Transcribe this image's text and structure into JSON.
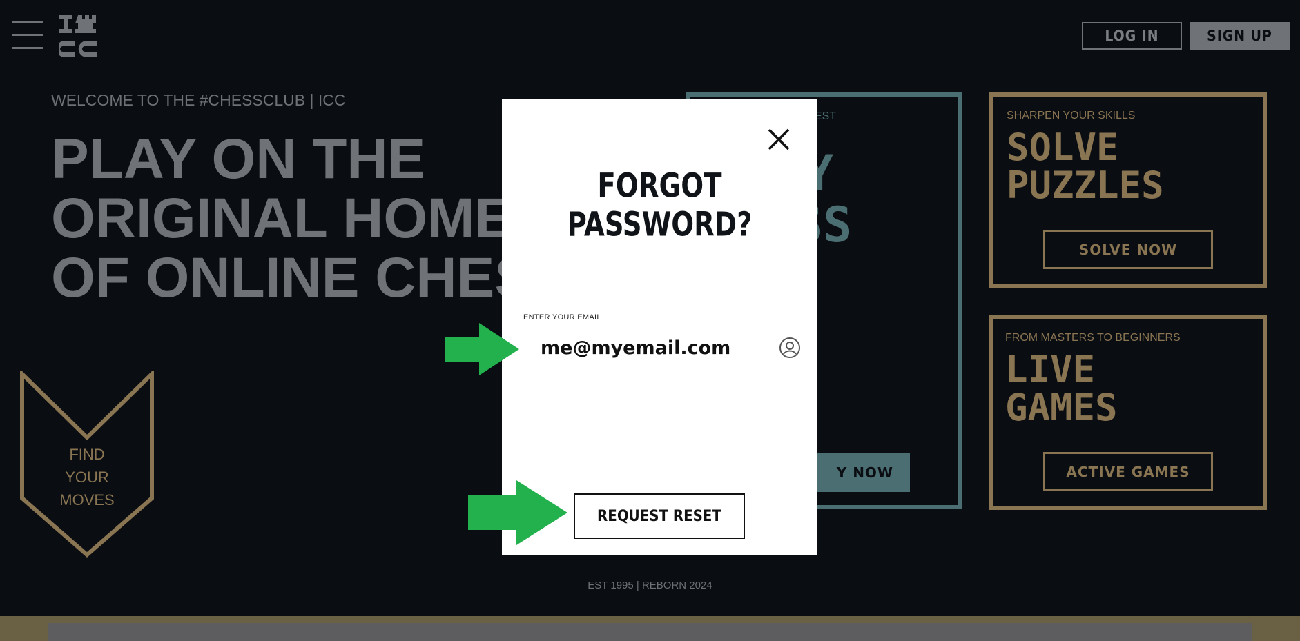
{
  "header": {
    "menu_icon": "hamburger-icon",
    "logo_icon": "icc-rook-logo",
    "login_label": "LOG IN",
    "signup_label": "SIGN UP"
  },
  "hero": {
    "welcome": "WELCOME TO THE #CHESSCLUB | ICC",
    "line1": "PLAY ON THE",
    "line2": "ORIGINAL HOME",
    "line3": "OF ONLINE CHESS"
  },
  "cards": {
    "teal": {
      "label_fragment": "EST",
      "big1_fragment": "Y",
      "big2_fragment": "SS",
      "button_fragment": "Y NOW"
    },
    "puzzles": {
      "label": "SHARPEN YOUR SKILLS",
      "title_line1": "SOLVE",
      "title_line2": "PUZZLES",
      "button": "SOLVE NOW"
    },
    "games": {
      "label": "FROM MASTERS TO BEGINNERS",
      "title_line1": "LIVE",
      "title_line2": "GAMES",
      "button": "ACTIVE GAMES"
    }
  },
  "chevron": {
    "line1": "FIND",
    "line2": "YOUR",
    "line3": "MOVES"
  },
  "footer": {
    "est": "EST 1995 | REBORN 2024"
  },
  "modal": {
    "title": "FORGOT PASSWORD?",
    "email_label": "ENTER YOUR EMAIL",
    "email_value": "me@myemail.com",
    "button": "REQUEST RESET",
    "close_icon": "close-icon",
    "user_icon": "user-circle-icon"
  },
  "colors": {
    "background": "#0a0d12",
    "gold": "#8a7552",
    "teal": "#4b6e72",
    "grey": "#6f7378",
    "arrow": "#22b14c"
  }
}
